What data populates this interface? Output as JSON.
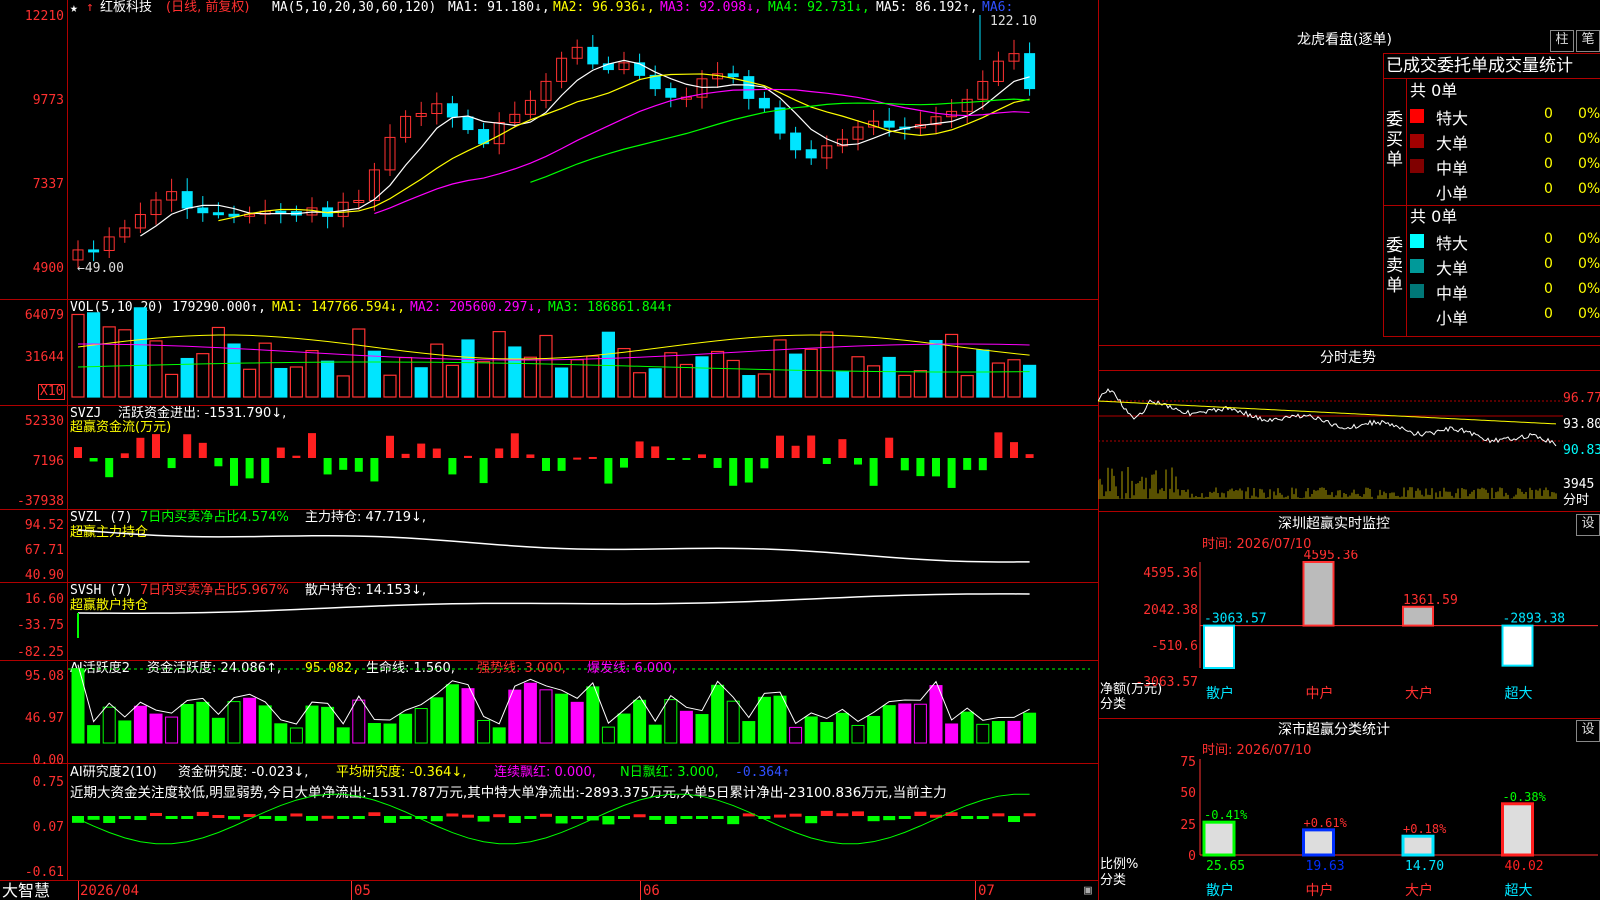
{
  "colors": {
    "up": "#ff3232",
    "down": "#00e5ff",
    "green": "#00ff00",
    "red": "#ff2020",
    "magenta": "#ff00ff",
    "yellow": "#ffff00",
    "white": "#ffffff",
    "grid": "#b00000"
  },
  "main": {
    "star": "★",
    "arrow_up_icon": "↑",
    "name": "红板科技",
    "period": "(日线, 前复权)",
    "ma_label": "MA(5,10,20,30,60,120)",
    "ma1": "MA1: 91.180↓,",
    "ma2": "MA2: 96.936↓,",
    "ma3": "MA3: 92.098↓,",
    "ma4": "MA4: 92.731↓,",
    "ma5": "MA5: 86.192↑,",
    "ma6": "MA6:",
    "high_mark": "122.10",
    "low_mark": "←49.00",
    "y_ticks": [
      "12210",
      "9773",
      "7337",
      "4900"
    ]
  },
  "vol": {
    "label": "VOL(5,10,20)",
    "value": "179290.000↑,",
    "ma1": "MA1: 147766.594↓,",
    "ma2": "MA2: 205600.297↓,",
    "ma3": "MA3: 186861.844↑",
    "y_ticks": [
      "64079",
      "31644"
    ],
    "unit": "X10"
  },
  "svzj": {
    "label": "SVZJ",
    "text": "活跃资金进出: -1531.790↓,",
    "sub": "超赢资金流(万元)",
    "y_ticks": [
      "52330",
      "7196",
      "-37938"
    ]
  },
  "svzl": {
    "label": "SVZL (7)",
    "text1": "7日内买卖净占比4.574%",
    "text2": "主力持仓: 47.719↓,",
    "sub": "超赢主力持仓",
    "y_ticks": [
      "94.52",
      "67.71",
      "40.90"
    ]
  },
  "svsh": {
    "label": "SVSH (7)",
    "text1": "7日内买卖净占比5.967%",
    "text2": "散户持仓: 14.153↓,",
    "sub": "超赢散户持仓",
    "y_ticks": [
      "16.60",
      "-33.75",
      "-82.25"
    ]
  },
  "ai_act": {
    "label": "AI活跃度2",
    "t1": "资金活跃度: 24.086↑,",
    "t2": "95.082,",
    "t3": "生命线: 1.560,",
    "t4": "强势线: 3.000,",
    "t5": "爆发线: 6.000,",
    "y_ticks": [
      "95.08",
      "46.97",
      "0.00"
    ]
  },
  "ai_res": {
    "label": "AI研究度2(10)",
    "t1": "资金研究度: -0.023↓,",
    "t2": "平均研究度: -0.364↓,",
    "t3": "连续飘红: 0.000,",
    "t4": "N日飘红: 3.000,",
    "t5": "-0.364↑",
    "comment": "近期大资金关注度较低,明显弱势,今日大单净流出:-1531.787万元,其中特大单净流出:-2893.375万元,大单5日累计净出-23100.836万元,当前主力",
    "y_ticks": [
      "0.75",
      "0.07",
      "-0.61"
    ]
  },
  "xaxis": {
    "brand": "大智慧",
    "labels": [
      "2026/04",
      "05",
      "06",
      "07"
    ]
  },
  "lhb": {
    "title": "龙虎看盘(逐单)",
    "btn1": "柱",
    "btn2": "笔",
    "tabs": "已成交委托单成交量统计",
    "buy_label": "委买单",
    "sell_label": "委卖单",
    "buy_total": "共 0单",
    "sell_total": "共 0单",
    "buy_rows": [
      {
        "name": "特大",
        "v": "0",
        "p": "0%",
        "color": "#ff0000"
      },
      {
        "name": "大单",
        "v": "0",
        "p": "0%",
        "color": "#a00000"
      },
      {
        "name": "中单",
        "v": "0",
        "p": "0%",
        "color": "#800000"
      },
      {
        "name": "小单",
        "v": "0",
        "p": "0%",
        "color": "#000000"
      }
    ],
    "sell_rows": [
      {
        "name": "特大",
        "v": "0",
        "p": "0%",
        "color": "#00ffff"
      },
      {
        "name": "大单",
        "v": "0",
        "p": "0%",
        "color": "#009999"
      },
      {
        "name": "中单",
        "v": "0",
        "p": "0%",
        "color": "#007777"
      },
      {
        "name": "小单",
        "v": "0",
        "p": "0%",
        "color": "#000000"
      }
    ]
  },
  "fenshi": {
    "title": "分时走势",
    "right_ticks": [
      "96.77",
      "93.80",
      "90.83",
      "3945",
      "分时"
    ]
  },
  "sz_rt": {
    "title": "深圳超赢实时监控",
    "set": "设",
    "time": "时间: 2026/07/10",
    "y_ticks": [
      "4595.36",
      "2042.38",
      "-510.6",
      "-3063.57"
    ],
    "axis_title": "净额(万元)",
    "axis_sub": "分类",
    "chart_data": {
      "type": "bar",
      "categories": [
        "散户",
        "中户",
        "大户",
        "超大"
      ],
      "values": [
        -3063.57,
        4595.36,
        1361.59,
        -2893.38
      ],
      "labels": [
        "-3063.57",
        "4595.36",
        "1361.59",
        "-2893.38"
      ],
      "ylim": [
        -3063.57,
        4595.36
      ]
    }
  },
  "sz_cls": {
    "title": "深市超赢分类统计",
    "set": "设",
    "time": "时间: 2026/07/10",
    "y_ticks": [
      "75",
      "50",
      "25",
      "0"
    ],
    "axis_title": "比例%",
    "axis_sub": "分类",
    "chart_data": {
      "type": "bar",
      "categories": [
        "散户",
        "中户",
        "大户",
        "超大"
      ],
      "values": [
        25.65,
        19.63,
        14.7,
        40.02
      ],
      "changes": [
        "-0.41%",
        "+0.61%",
        "+0.18%",
        "-0.38%"
      ],
      "ylim": [
        0,
        75
      ]
    }
  }
}
